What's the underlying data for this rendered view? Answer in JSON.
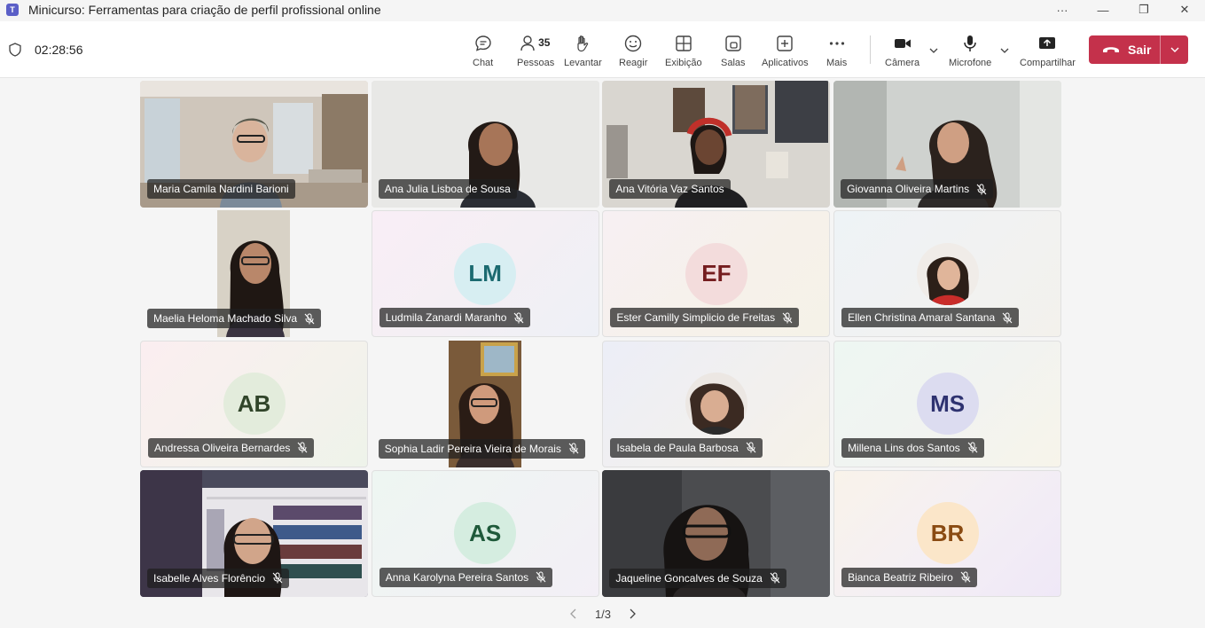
{
  "window": {
    "title": "Minicurso: Ferramentas para criação de perfil profissional online",
    "controls": [
      "more-icon",
      "minimize-icon",
      "restore-icon",
      "close-icon"
    ]
  },
  "toolbar": {
    "timer": "02:28:56",
    "chat": "Chat",
    "people": "Pessoas",
    "people_count": "35",
    "raise": "Levantar",
    "react": "Reagir",
    "view": "Exibição",
    "rooms": "Salas",
    "apps": "Aplicativos",
    "more": "Mais",
    "camera": "Câmera",
    "mic": "Microfone",
    "share": "Compartilhar",
    "leave": "Sair"
  },
  "colors": {
    "accent": "#5b5fc7",
    "leave_red": "#c4314b"
  },
  "participants": [
    {
      "name": "Maria Camila Nardini Barioni",
      "muted": false,
      "type": "video"
    },
    {
      "name": "Ana Julia Lisboa de Sousa",
      "muted": false,
      "type": "video"
    },
    {
      "name": "Ana Vitória Vaz Santos",
      "muted": false,
      "type": "video"
    },
    {
      "name": "Giovanna Oliveira Martins",
      "muted": true,
      "type": "video"
    },
    {
      "name": "Maelia Heloma Machado Silva",
      "muted": true,
      "type": "video"
    },
    {
      "name": "Ludmila Zanardi Maranho",
      "muted": true,
      "type": "initials",
      "initials": "LM"
    },
    {
      "name": "Ester Camilly Simplicio de Freitas",
      "muted": true,
      "type": "initials",
      "initials": "EF"
    },
    {
      "name": "Ellen Christina Amaral Santana",
      "muted": true,
      "type": "photo"
    },
    {
      "name": "Andressa Oliveira Bernardes",
      "muted": true,
      "type": "initials",
      "initials": "AB"
    },
    {
      "name": "Sophia Ladir Pereira Vieira de Morais",
      "muted": true,
      "type": "video"
    },
    {
      "name": "Isabela de Paula Barbosa",
      "muted": true,
      "type": "photo"
    },
    {
      "name": "Millena Lins dos Santos",
      "muted": true,
      "type": "initials",
      "initials": "MS"
    },
    {
      "name": "Isabelle Alves Florêncio",
      "muted": true,
      "type": "video"
    },
    {
      "name": "Anna Karolyna Pereira Santos",
      "muted": true,
      "type": "initials",
      "initials": "AS"
    },
    {
      "name": "Jaqueline Goncalves de Souza",
      "muted": true,
      "type": "video"
    },
    {
      "name": "Bianca Beatriz Ribeiro",
      "muted": true,
      "type": "initials",
      "initials": "BR"
    }
  ],
  "pagination": {
    "label": "1/3"
  }
}
